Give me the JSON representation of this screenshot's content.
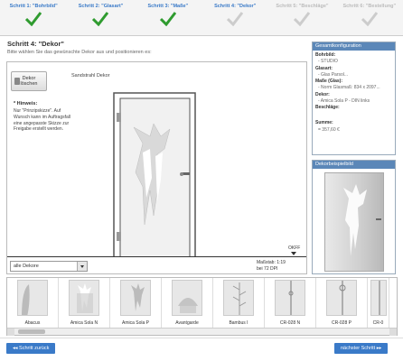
{
  "steps": [
    {
      "label": "Schritt 1: \"Bohrbild\"",
      "done": true
    },
    {
      "label": "Schritt 2: \"Glasart\"",
      "done": true
    },
    {
      "label": "Schritt 3: \"Maße\"",
      "done": true
    },
    {
      "label": "Schritt 4: \"Dekor\"",
      "done": false,
      "current": true
    },
    {
      "label": "Schritt 5: \"Beschläge\"",
      "done": false
    },
    {
      "label": "Schritt 6: \"Bestellung\"",
      "done": false
    }
  ],
  "main": {
    "title": "Schritt 4: \"Dekor\"",
    "subtitle": "Bitte wählen Sie das gewünschte Dekor aus und positionieren es:"
  },
  "designer": {
    "delete_label_1": "Dekor",
    "delete_label_2": "löschen",
    "dekor_name": "Sandstrahl Dekor",
    "hint_title": "* Hinweis:",
    "hint_text": "Nur \"Prinzipskizze\". Auf Wunsch kann im Auftragsfall eine angepasste Skizze zur Freigabe erstellt werden.",
    "okff": "OKFF",
    "scale_1": "Maßstab: 1:19",
    "scale_2": "bei 72 DPI",
    "filter_value": "alle Dekore"
  },
  "config": {
    "header": "Gesamtkonfiguration",
    "rows": [
      {
        "key": "Bohrbild:",
        "value": "- STUDIO"
      },
      {
        "key": "Glasart:",
        "value": "- Glas Parsol..."
      },
      {
        "key": "Maße (Glas):",
        "value": "- Norm Glasmaß: 834 x 2097..."
      },
      {
        "key": "Dekor:",
        "value": "- Amica Sola P - DIN links"
      },
      {
        "key": "Beschläge:",
        "value": ""
      }
    ],
    "sum_label": "Summe:",
    "sum_value": "= 357,60 €"
  },
  "preview": {
    "header": "Dekorbeispielbild"
  },
  "thumbnails": [
    {
      "label": "Abacus"
    },
    {
      "label": "Amica Sola N"
    },
    {
      "label": "Amica Sola P"
    },
    {
      "label": "Avantgarde"
    },
    {
      "label": "Bambus I"
    },
    {
      "label": "CR-028 N"
    },
    {
      "label": "CR-028 P"
    },
    {
      "label": "CR-0"
    }
  ],
  "nav": {
    "prev": "◂◂ Schritt zurück",
    "next": "nächster Schritt ▸▸"
  },
  "colors": {
    "accent": "#3a7ac8",
    "check": "#2f9b2f",
    "check_disabled": "#cccccc"
  }
}
